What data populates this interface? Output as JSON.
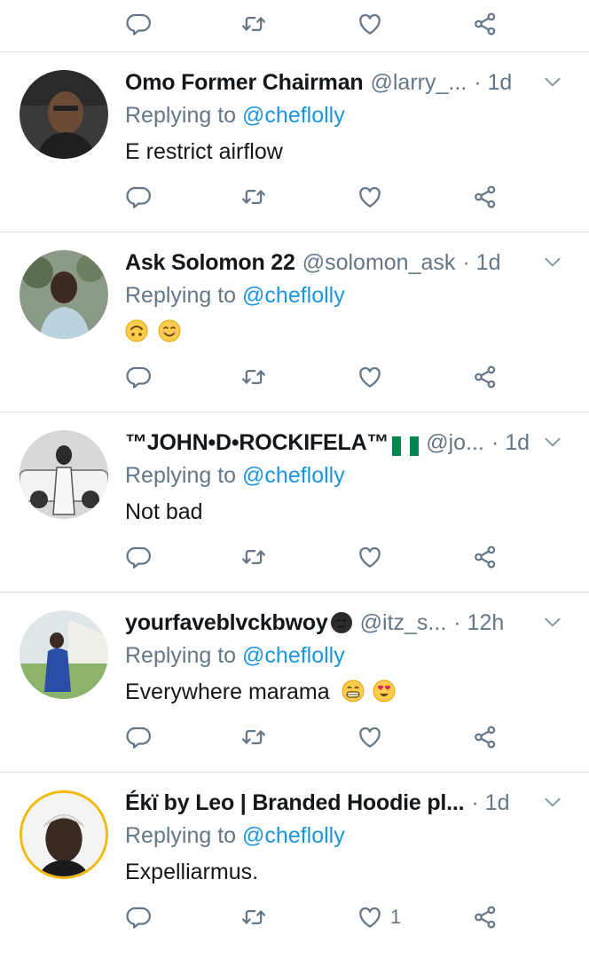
{
  "top_actions": {
    "like_count": ""
  },
  "tweets": [
    {
      "name": "Omo Former Chairman",
      "handle": "@larry_...",
      "time": "· 1d",
      "replying_prefix": "Replying to",
      "replying_to": "@cheflolly",
      "text": "E restrict airflow",
      "like_count": ""
    },
    {
      "name": "Ask Solomon 22",
      "handle": "@solomon_ask",
      "time": "· 1d",
      "replying_prefix": "Replying to",
      "replying_to": "@cheflolly",
      "text": "",
      "emojis": [
        "upside-down-face",
        "smiling-face"
      ],
      "like_count": ""
    },
    {
      "name": "™JOHN•D•ROCKIFELA™",
      "flag": "nigeria-flag",
      "handle": "@jo...",
      "time": "· 1d",
      "replying_prefix": "Replying to",
      "replying_to": "@cheflolly",
      "text": "Not bad",
      "like_count": ""
    },
    {
      "name": "yourfaveblvckbwoy",
      "name_emoji": "dark-face",
      "handle": "@itz_s...",
      "time": "· 12h",
      "replying_prefix": "Replying to",
      "replying_to": "@cheflolly",
      "text": "Everywhere marama",
      "emojis": [
        "grinning-face",
        "heart-eyes-face"
      ],
      "like_count": ""
    },
    {
      "name": "Ékï by Leo | Branded Hoodie pl...",
      "handle": "",
      "time": "· 1d",
      "replying_prefix": "Replying to",
      "replying_to": "@cheflolly",
      "text": "Expelliarmus.",
      "like_count": "1"
    }
  ],
  "colors": {
    "text": "#14171a",
    "secondary": "#657786",
    "link": "#1b95e0",
    "divider": "#dfe3e7"
  },
  "icons": [
    "reply-icon",
    "retweet-icon",
    "like-icon",
    "share-icon",
    "chevron-down-icon"
  ]
}
